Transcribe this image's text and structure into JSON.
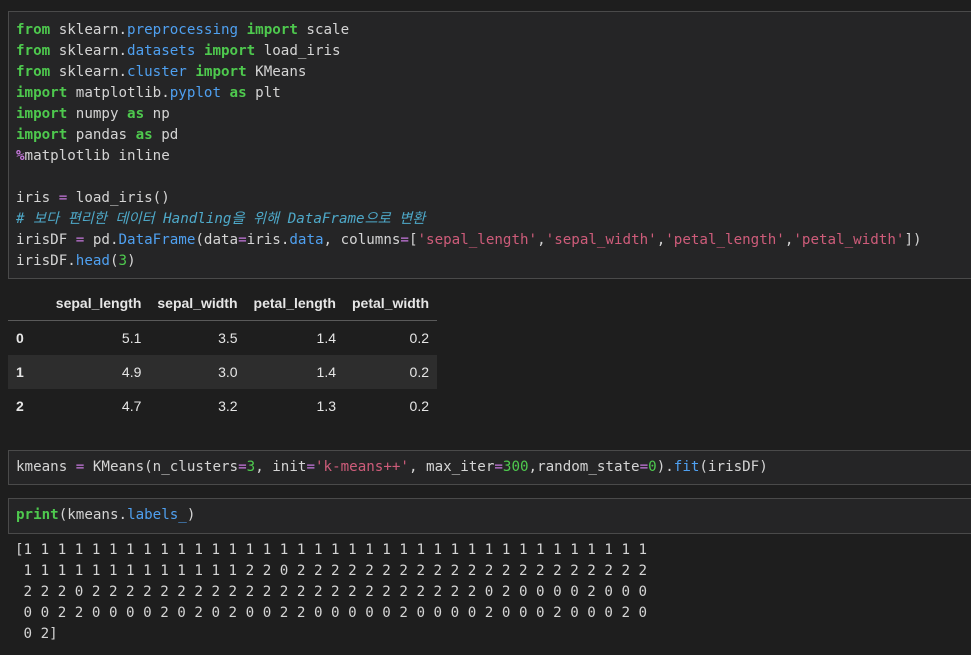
{
  "cell1": {
    "lines": [
      [
        {
          "t": "kw",
          "v": "from"
        },
        {
          "t": "",
          "v": " sklearn."
        },
        {
          "t": "mod",
          "v": "preprocessing"
        },
        {
          "t": "",
          "v": " "
        },
        {
          "t": "kw",
          "v": "import"
        },
        {
          "t": "",
          "v": " scale"
        }
      ],
      [
        {
          "t": "kw",
          "v": "from"
        },
        {
          "t": "",
          "v": " sklearn."
        },
        {
          "t": "mod",
          "v": "datasets"
        },
        {
          "t": "",
          "v": " "
        },
        {
          "t": "kw",
          "v": "import"
        },
        {
          "t": "",
          "v": " load_iris"
        }
      ],
      [
        {
          "t": "kw",
          "v": "from"
        },
        {
          "t": "",
          "v": " sklearn."
        },
        {
          "t": "mod",
          "v": "cluster"
        },
        {
          "t": "",
          "v": " "
        },
        {
          "t": "kw",
          "v": "import"
        },
        {
          "t": "",
          "v": " KMeans"
        }
      ],
      [
        {
          "t": "kw",
          "v": "import"
        },
        {
          "t": "",
          "v": " matplotlib."
        },
        {
          "t": "mod",
          "v": "pyplot"
        },
        {
          "t": "",
          "v": " "
        },
        {
          "t": "kw",
          "v": "as"
        },
        {
          "t": "",
          "v": " plt"
        }
      ],
      [
        {
          "t": "kw",
          "v": "import"
        },
        {
          "t": "",
          "v": " numpy "
        },
        {
          "t": "kw",
          "v": "as"
        },
        {
          "t": "",
          "v": " np"
        }
      ],
      [
        {
          "t": "kw",
          "v": "import"
        },
        {
          "t": "",
          "v": " pandas "
        },
        {
          "t": "kw",
          "v": "as"
        },
        {
          "t": "",
          "v": " pd"
        }
      ],
      [
        {
          "t": "pct",
          "v": "%"
        },
        {
          "t": "",
          "v": "matplotlib inline"
        }
      ],
      [
        {
          "t": "",
          "v": ""
        }
      ],
      [
        {
          "t": "",
          "v": "iris "
        },
        {
          "t": "op",
          "v": "="
        },
        {
          "t": "",
          "v": " load_iris()"
        }
      ],
      [
        {
          "t": "cmt",
          "v": "# 보다 편리한 데이터 Handling을 위해 DataFrame으로 변환"
        }
      ],
      [
        {
          "t": "",
          "v": "irisDF "
        },
        {
          "t": "op",
          "v": "="
        },
        {
          "t": "",
          "v": " pd."
        },
        {
          "t": "fn",
          "v": "DataFrame"
        },
        {
          "t": "",
          "v": "(data"
        },
        {
          "t": "op",
          "v": "="
        },
        {
          "t": "",
          "v": "iris."
        },
        {
          "t": "fn",
          "v": "data"
        },
        {
          "t": "",
          "v": ", columns"
        },
        {
          "t": "op",
          "v": "="
        },
        {
          "t": "",
          "v": "["
        },
        {
          "t": "str",
          "v": "'sepal_length'"
        },
        {
          "t": "",
          "v": ","
        },
        {
          "t": "str",
          "v": "'sepal_width'"
        },
        {
          "t": "",
          "v": ","
        },
        {
          "t": "str",
          "v": "'petal_length'"
        },
        {
          "t": "",
          "v": ","
        },
        {
          "t": "str",
          "v": "'petal_width'"
        },
        {
          "t": "",
          "v": "])"
        }
      ],
      [
        {
          "t": "",
          "v": "irisDF."
        },
        {
          "t": "fn",
          "v": "head"
        },
        {
          "t": "",
          "v": "("
        },
        {
          "t": "num",
          "v": "3"
        },
        {
          "t": "",
          "v": ")"
        }
      ]
    ]
  },
  "dataframe": {
    "columns": [
      "sepal_length",
      "sepal_width",
      "petal_length",
      "petal_width"
    ],
    "rows": [
      {
        "index": "0",
        "values": [
          "5.1",
          "3.5",
          "1.4",
          "0.2"
        ]
      },
      {
        "index": "1",
        "values": [
          "4.9",
          "3.0",
          "1.4",
          "0.2"
        ]
      },
      {
        "index": "2",
        "values": [
          "4.7",
          "3.2",
          "1.3",
          "0.2"
        ]
      }
    ]
  },
  "cell2": {
    "lines": [
      [
        {
          "t": "",
          "v": "kmeans "
        },
        {
          "t": "op",
          "v": "="
        },
        {
          "t": "",
          "v": " KMeans(n_clusters"
        },
        {
          "t": "op",
          "v": "="
        },
        {
          "t": "num",
          "v": "3"
        },
        {
          "t": "",
          "v": ", init"
        },
        {
          "t": "op",
          "v": "="
        },
        {
          "t": "str",
          "v": "'k-means++'"
        },
        {
          "t": "",
          "v": ", max_iter"
        },
        {
          "t": "op",
          "v": "="
        },
        {
          "t": "num",
          "v": "300"
        },
        {
          "t": "",
          "v": ",random_state"
        },
        {
          "t": "op",
          "v": "="
        },
        {
          "t": "num",
          "v": "0"
        },
        {
          "t": "",
          "v": ")."
        },
        {
          "t": "fn",
          "v": "fit"
        },
        {
          "t": "",
          "v": "(irisDF)"
        }
      ]
    ]
  },
  "cell3": {
    "lines": [
      [
        {
          "t": "kw",
          "v": "print"
        },
        {
          "t": "",
          "v": "(kmeans."
        },
        {
          "t": "fn",
          "v": "labels_"
        },
        {
          "t": "",
          "v": ")"
        }
      ]
    ]
  },
  "labels_output": "[1 1 1 1 1 1 1 1 1 1 1 1 1 1 1 1 1 1 1 1 1 1 1 1 1 1 1 1 1 1 1 1 1 1 1 1 1\n 1 1 1 1 1 1 1 1 1 1 1 1 1 2 2 0 2 2 2 2 2 2 2 2 2 2 2 2 2 2 2 2 2 2 2 2 2\n 2 2 2 0 2 2 2 2 2 2 2 2 2 2 2 2 2 2 2 2 2 2 2 2 2 2 2 0 2 0 0 0 0 2 0 0 0\n 0 0 2 2 0 0 0 0 2 0 2 0 2 0 0 2 2 0 0 0 0 0 2 0 0 0 0 2 0 0 0 2 0 0 0 2 0\n 0 2]"
}
